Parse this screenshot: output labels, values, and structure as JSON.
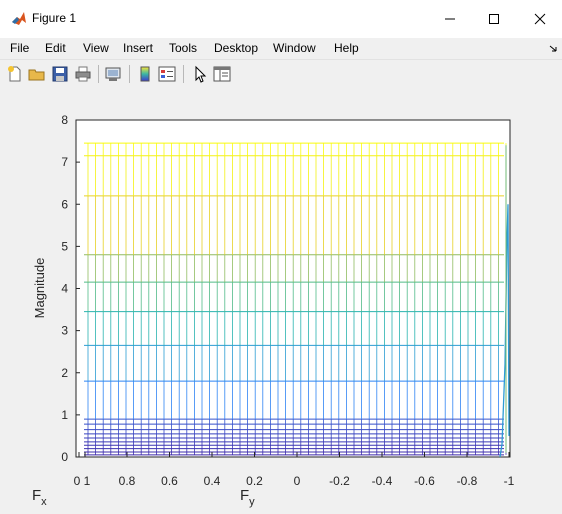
{
  "window": {
    "title": "Figure 1"
  },
  "menu": [
    "File",
    "Edit",
    "View",
    "Insert",
    "Tools",
    "Desktop",
    "Window",
    "Help"
  ],
  "toolbar_icons": [
    "new-figure-icon",
    "open-file-icon",
    "save-icon",
    "print-icon",
    "link-plot-icon",
    "insert-colorbar-icon",
    "insert-legend-icon",
    "edit-plot-icon",
    "property-inspector-icon"
  ],
  "chart_data": {
    "type": "line",
    "ylabel": "Magnitude",
    "xlabel": "Fx",
    "zlabel": "Fy",
    "y_ticks": [
      "0",
      "1",
      "2",
      "3",
      "4",
      "5",
      "6",
      "7",
      "8"
    ],
    "x_ticks": [
      "0",
      "1",
      "0.8",
      "0.6",
      "0.4",
      "0.2",
      "0",
      "-0.2",
      "-0.4",
      "-0.6",
      "-0.8",
      "-1"
    ],
    "ylim": [
      0,
      8
    ],
    "fy_range": [
      1,
      -1
    ],
    "grid": false,
    "colormap": "parula",
    "series_levels": [
      0.05,
      0.12,
      0.2,
      0.28,
      0.36,
      0.45,
      0.55,
      0.65,
      0.78,
      0.9,
      1.8,
      2.65,
      3.45,
      4.15,
      4.8,
      6.2,
      7.15,
      7.45
    ]
  },
  "colors": {
    "axes_bg": "#ffffff",
    "window_bg": "#f0f0f0",
    "title_bg": "#ffffff"
  }
}
